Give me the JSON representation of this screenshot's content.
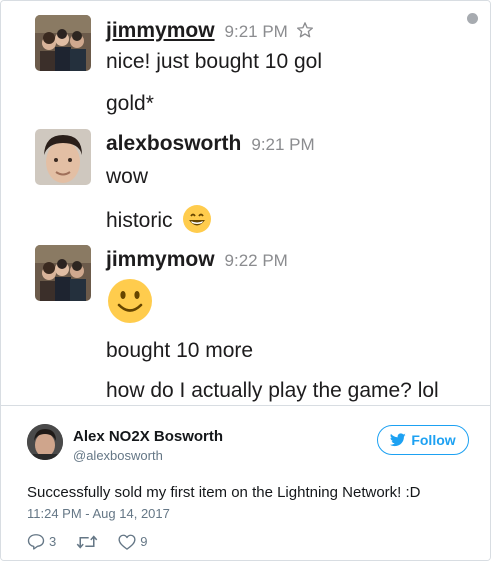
{
  "messages": [
    {
      "user": "jimmymow",
      "time": "9:21 PM",
      "lines": [
        "nice! just bought 10 gol",
        "gold*"
      ]
    },
    {
      "user": "alexbosworth",
      "time": "9:21 PM",
      "lines": [
        "wow",
        "historic"
      ]
    },
    {
      "user": "jimmymow",
      "time": "9:22 PM",
      "lines": [
        "bought 10 more",
        "how do I actually play the game? lol"
      ]
    }
  ],
  "tweet": {
    "name": "Alex NO2X Bosworth",
    "handle": "@alexbosworth",
    "follow_label": "Follow",
    "text": "Successfully sold my first item on the Lightning Network! :D",
    "date": "11:24 PM - Aug 14, 2017",
    "reply_count": "3",
    "like_count": "9"
  },
  "colors": {
    "accent": "#1da1f2",
    "muted": "#657786",
    "slack_time": "#8b8c8f"
  },
  "icons": [
    "star-icon",
    "info-icon",
    "grinning-emoji-icon",
    "smiling-emoji-icon",
    "twitter-bird-icon",
    "reply-icon",
    "retweet-icon",
    "heart-icon"
  ]
}
